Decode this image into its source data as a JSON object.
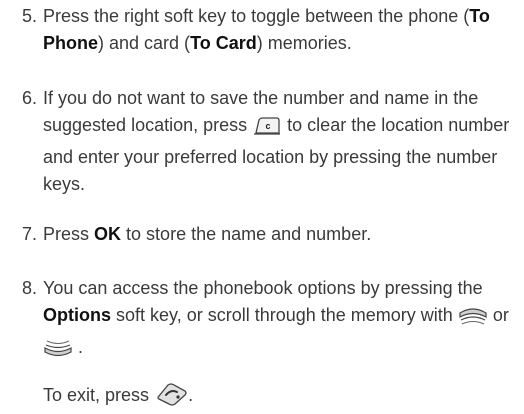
{
  "steps": [
    {
      "num": "5.",
      "p1": "Press the right soft key to toggle between the phone (",
      "b1": "To Phone",
      "p2": ") and card (",
      "b2": "To Card",
      "p3": ") memories."
    },
    {
      "num": "6.",
      "p1": "If you do not want to save the number and name in the suggested location, press",
      "p2": "to clear the location number and enter your preferred location by pressing the number keys."
    },
    {
      "num": "7.",
      "p1": "Press",
      "b1": "OK",
      "p2": "to store the name and number."
    },
    {
      "num": "8.",
      "p1": "You can access the phonebook options by pressing the",
      "b1": "Options",
      "p2": "soft key, or scroll through the memory with",
      "p3": "or",
      "p4": "."
    }
  ],
  "exit": {
    "p1": "To exit, press",
    "p2": "."
  },
  "icons": [
    "c-key-icon",
    "up-navigation-key-icon",
    "down-navigation-key-icon",
    "end-key-icon"
  ]
}
